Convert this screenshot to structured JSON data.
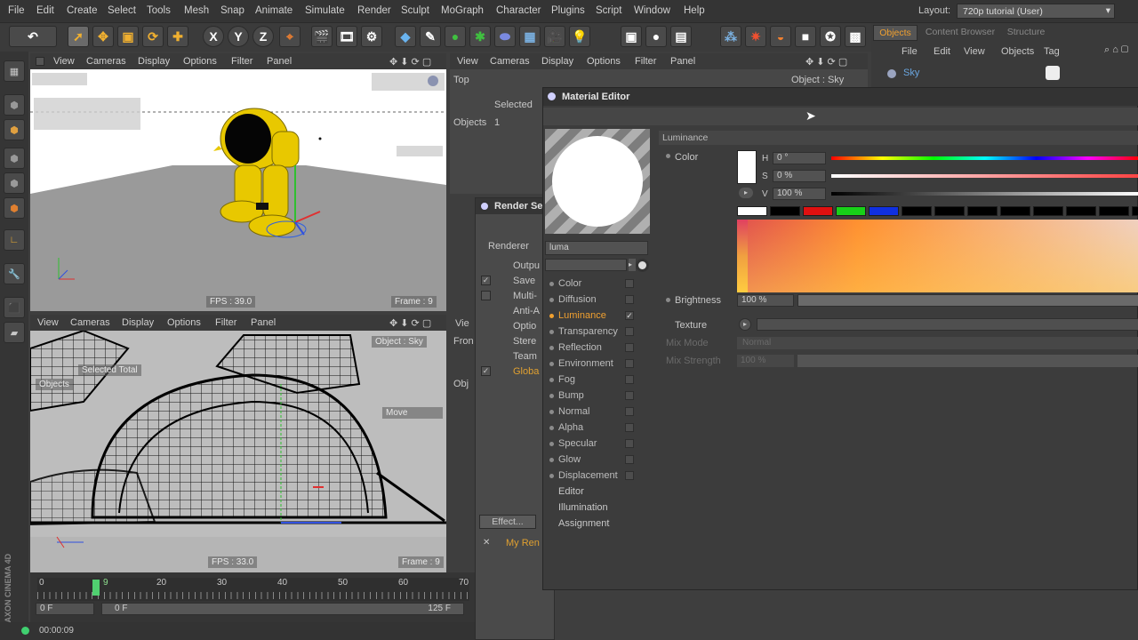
{
  "menubar": {
    "items": [
      "File",
      "Edit",
      "Create",
      "Select",
      "Tools",
      "Mesh",
      "Snap",
      "Animate",
      "Simulate",
      "Render",
      "Sculpt",
      "MoGraph",
      "Character",
      "Plugins",
      "Script",
      "Window",
      "Help"
    ],
    "layout_label": "Layout:",
    "layout_value": "720p tutorial (User)"
  },
  "toolbar": {
    "axis_x": "X",
    "axis_y": "Y",
    "axis_z": "Z"
  },
  "viewport_menu": [
    "View",
    "Cameras",
    "Display",
    "Options",
    "Filter",
    "Panel"
  ],
  "viewport1": {
    "fps": "FPS : 39.0",
    "frame": "Frame : 9"
  },
  "viewport2": {
    "object_label": "Object : Sky",
    "move_label": "Move",
    "selected_total": "Selected Total",
    "objects_label": "Objects",
    "fps": "FPS : 33.0",
    "frame": "Frame : 9"
  },
  "viewport3": {
    "view_name": "Top",
    "object_label": "Object : Sky",
    "selected": "Selected",
    "objects_label": "Objects",
    "objects_count": "1",
    "view_short": "Vie",
    "front_short": "Fron",
    "obj_short": "Obj"
  },
  "render_settings": {
    "title": "Render Se",
    "renderer_label": "Renderer",
    "items": [
      "Outpu",
      "Save",
      "Multi-",
      "Anti-A",
      "Optio",
      "Stere",
      "Team",
      "Globa"
    ],
    "effect_button": "Effect...",
    "preset": "My Ren"
  },
  "timeline": {
    "ticks": [
      "0",
      "10",
      "20",
      "30",
      "40",
      "50",
      "60",
      "70"
    ],
    "current_frame_marker": "9",
    "start_field": "0 F",
    "range_start": "0 F",
    "range_end": "125 F",
    "timecode": "00:00:09"
  },
  "object_manager": {
    "tabs": [
      "Objects",
      "Content Browser",
      "Structure"
    ],
    "menu": [
      "File",
      "Edit",
      "View",
      "Objects",
      "Tag"
    ],
    "object_name": "Sky"
  },
  "material_editor": {
    "title": "Material Editor",
    "name_field": "luma",
    "section": "Luminance",
    "channels": [
      {
        "name": "Color",
        "checked": false,
        "active": false
      },
      {
        "name": "Diffusion",
        "checked": false,
        "active": false
      },
      {
        "name": "Luminance",
        "checked": true,
        "active": true
      },
      {
        "name": "Transparency",
        "checked": false,
        "active": false
      },
      {
        "name": "Reflection",
        "checked": false,
        "active": false
      },
      {
        "name": "Environment",
        "checked": false,
        "active": false
      },
      {
        "name": "Fog",
        "checked": false,
        "active": false
      },
      {
        "name": "Bump",
        "checked": false,
        "active": false
      },
      {
        "name": "Normal",
        "checked": false,
        "active": false
      },
      {
        "name": "Alpha",
        "checked": false,
        "active": false
      },
      {
        "name": "Specular",
        "checked": false,
        "active": false
      },
      {
        "name": "Glow",
        "checked": false,
        "active": false
      },
      {
        "name": "Displacement",
        "checked": false,
        "active": false
      }
    ],
    "extra_items": [
      "Editor",
      "Illumination",
      "Assignment"
    ],
    "color_label": "Color",
    "h_label": "H",
    "h_value": "0 °",
    "s_label": "S",
    "s_value": "0 %",
    "v_label": "V",
    "v_value": "100 %",
    "brightness_label": "Brightness",
    "brightness_value": "100 %",
    "brightness_level": 1.0,
    "texture_label": "Texture",
    "mix_mode_label": "Mix Mode",
    "mix_mode_value": "Normal",
    "mix_strength_label": "Mix Strength",
    "mix_strength_value": "100 %",
    "swatch_colors": [
      "#ffffff",
      "#000000",
      "#e01010",
      "#18d018",
      "#1030e0",
      "#000000",
      "#000000",
      "#000000",
      "#000000",
      "#000000",
      "#000000",
      "#000000",
      "#000000"
    ]
  },
  "left_bar": {
    "brand": "MAXON CINEMA 4D"
  }
}
